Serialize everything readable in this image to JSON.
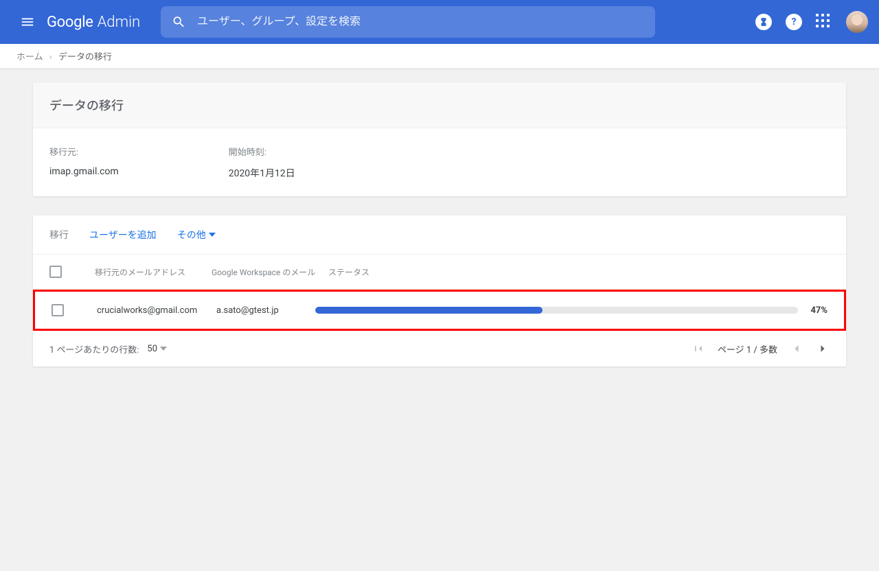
{
  "header": {
    "logo_google": "Google",
    "logo_admin": "Admin",
    "search_placeholder": "ユーザー、グループ、設定を検索"
  },
  "breadcrumb": {
    "home": "ホーム",
    "current": "データの移行"
  },
  "summary": {
    "title": "データの移行",
    "source_label": "移行元:",
    "source_value": "imap.gmail.com",
    "start_label": "開始時刻:",
    "start_value": "2020年1月12日"
  },
  "table": {
    "section_label": "移行",
    "add_user": "ユーザーを追加",
    "more": "その他",
    "columns": {
      "source": "移行元のメールアドレス",
      "dest": "Google Workspace のメール",
      "status": "ステータス"
    },
    "rows": [
      {
        "source": "crucialworks@gmail.com",
        "dest": "a.sato@gtest.jp",
        "percent": 47
      }
    ]
  },
  "footer": {
    "rows_per_page_label": "1 ページあたりの行数:",
    "rows_per_page_value": "50",
    "page_text": "ページ 1 / 多数"
  }
}
